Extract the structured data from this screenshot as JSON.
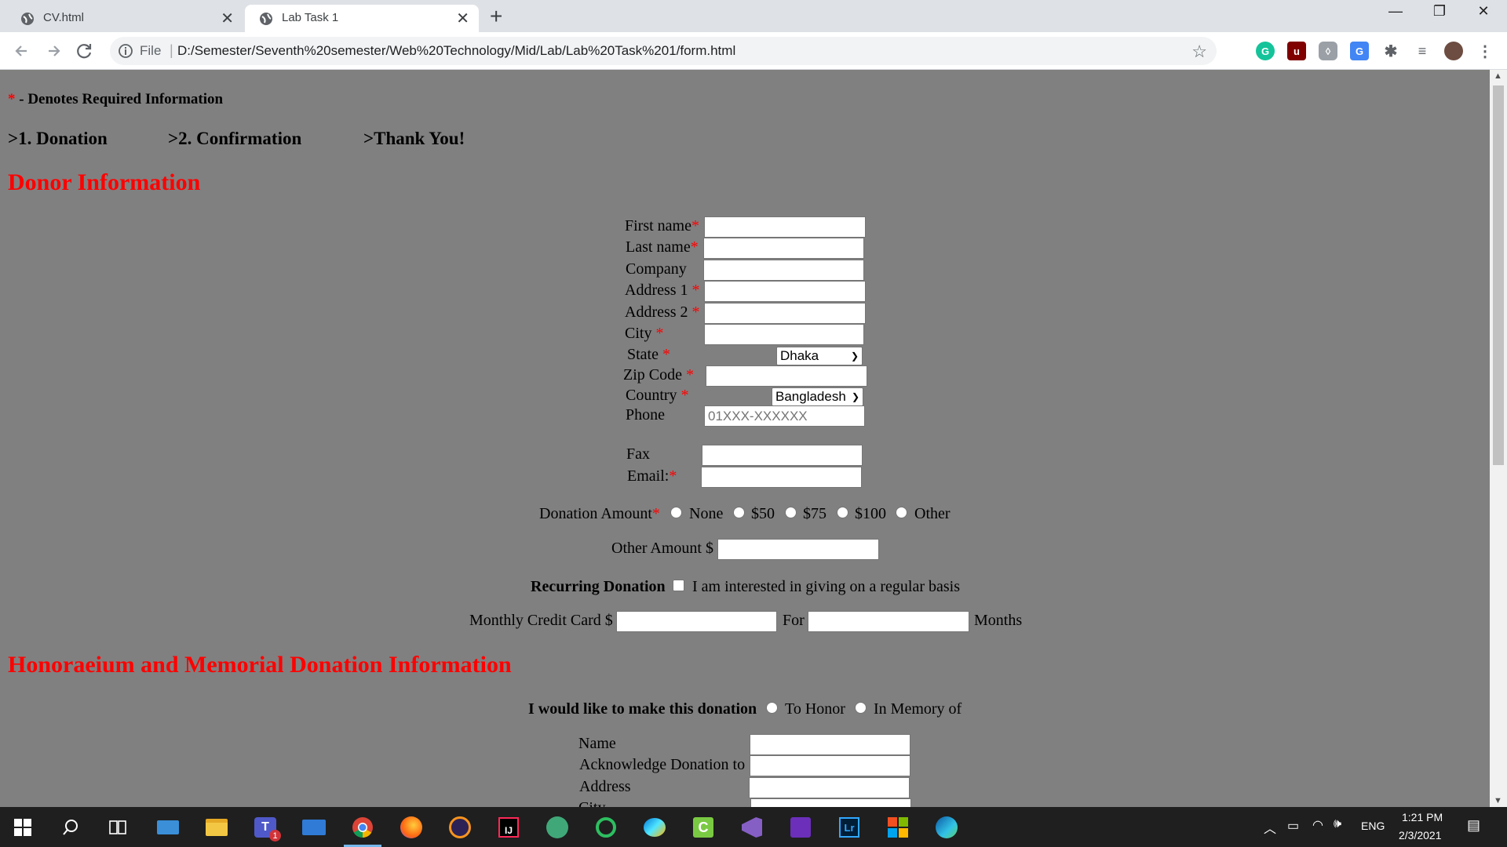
{
  "browser": {
    "tabs": [
      {
        "title": "CV.html",
        "active": false
      },
      {
        "title": "Lab Task 1",
        "active": true
      }
    ],
    "address": {
      "scheme_label": "File",
      "url": "D:/Semester/Seventh%20semester/Web%20Technology/Mid/Lab/Lab%20Task%201/form.html"
    }
  },
  "page": {
    "legend_star": "*",
    "legend_text": " - Denotes Required Information",
    "steps": [
      ">1. Donation",
      ">2. Confirmation",
      ">Thank You!"
    ],
    "donor_heading": "Donor Information",
    "donor_fields": {
      "first_name": {
        "label": "First name",
        "star": "*",
        "value": ""
      },
      "last_name": {
        "label": "Last name",
        "star": "*",
        "value": ""
      },
      "company": {
        "label": "Company",
        "value": ""
      },
      "address1": {
        "label": "Address 1 ",
        "star": "*",
        "value": ""
      },
      "address2": {
        "label": "Address 2 ",
        "star": "*",
        "value": ""
      },
      "city": {
        "label": "City ",
        "star": "*",
        "value": ""
      },
      "state": {
        "label": "State ",
        "star": "*",
        "selected": "Dhaka"
      },
      "zip": {
        "label": "Zip Code ",
        "star": "*",
        "value": ""
      },
      "country": {
        "label": "Country ",
        "star": "*",
        "selected": "Bangladesh"
      },
      "phone": {
        "label": "Phone",
        "placeholder": "01XXX-XXXXXX"
      },
      "fax": {
        "label": "Fax",
        "value": ""
      },
      "email": {
        "label": "Email:",
        "star": "*",
        "value": ""
      }
    },
    "donation_amount": {
      "label": "Donation Amount",
      "star": "*",
      "options": [
        "None",
        "$50",
        "$75",
        "$100",
        "Other"
      ]
    },
    "other_amount_label": "Other Amount $",
    "recurring": {
      "label": "Recurring Donation",
      "checkbox_text": "I am interested in giving on a regular basis"
    },
    "monthly": {
      "label": "Monthly Credit Card $",
      "for_label": "For",
      "months_label": "Months"
    },
    "honor_heading": "Honoraeium and Memorial Donation Information",
    "honor": {
      "prompt": "I would like to make this donation",
      "options": [
        "To Honor",
        "In Memory of"
      ],
      "fields": [
        "Name",
        "Acknowledge Donation to",
        "Address",
        "City"
      ]
    }
  },
  "taskbar": {
    "lang": "ENG",
    "time": "1:21 PM",
    "date": "2/3/2021",
    "teams_badge": "1"
  },
  "colors": {
    "accent_red": "#ff0000",
    "page_bg": "#808080",
    "taskbar_bg": "#1f1f1f"
  }
}
